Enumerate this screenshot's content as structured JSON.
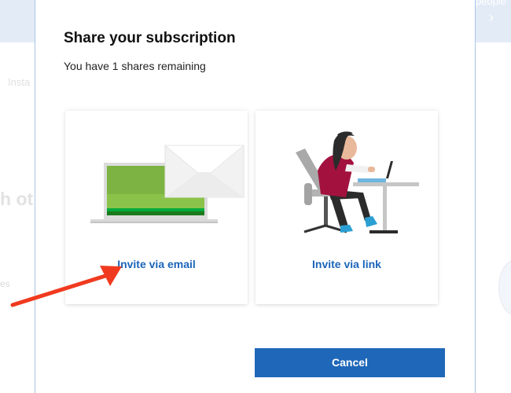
{
  "background": {
    "people_fragment": "people",
    "chevron": "›",
    "insta_fragment": "Insta",
    "heading_fragment": "h ot",
    "list_fragment": "es"
  },
  "dialog": {
    "title": "Share your subscription",
    "subtitle": "You have 1 shares remaining",
    "options": [
      {
        "label": "Invite via email",
        "illustration": "laptop-envelope-illustration"
      },
      {
        "label": "Invite via link",
        "illustration": "person-at-laptop-illustration"
      }
    ],
    "cancel_label": "Cancel"
  },
  "annotation": {
    "type": "red-arrow",
    "points_to": "Invite via email",
    "color": "#f03a1f"
  },
  "colors": {
    "accent": "#1f67b8",
    "link": "#1b65b9",
    "banner": "#e3ebf6"
  }
}
